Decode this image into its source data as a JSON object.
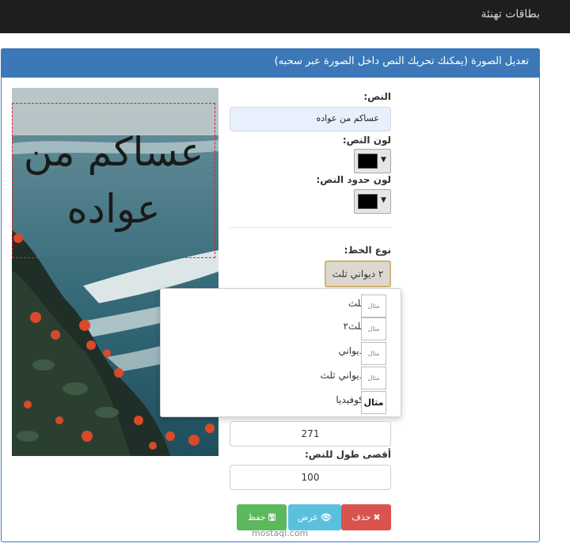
{
  "app": {
    "brand": "بطاقات تهنئة"
  },
  "panel": {
    "title": "تعديل الصورة (يمكنك تحريك النص داخل الصورة عبر سحبه)"
  },
  "card": {
    "line1": "عساكم من",
    "line2": "عواده"
  },
  "form": {
    "text_label": "النص:",
    "text_value": "عساكم من عواده",
    "text_color_label": "لون النص:",
    "text_color": "#000000",
    "border_color_label": "لون حدود النص:",
    "border_color": "#000000",
    "font_label": "نوع الخط:",
    "font_selected": "٢ ديواني ثلث",
    "number_value": "271",
    "max_length_label": "أقصى طول للنص:",
    "max_length_value": "100"
  },
  "font_options": [
    {
      "label": "ثلث",
      "thumb": "مثال"
    },
    {
      "label": "ثلث٢",
      "thumb": "مثال"
    },
    {
      "label": "ديواني",
      "thumb": "مثال"
    },
    {
      "label": "ديواني ثلث",
      "thumb": "مثال"
    },
    {
      "label": "كوفيديا",
      "thumb": "مثال"
    }
  ],
  "buttons": {
    "delete": "حذف",
    "view": "عرض",
    "save": "حفظ"
  },
  "icons": {
    "delete": "times-icon",
    "view": "eye-icon",
    "save": "floppy-icon",
    "caret": "caret-down-icon"
  },
  "colors": {
    "topbar": "#1e1e1e",
    "panel_header": "#3c78b8",
    "delete": "#d9534f",
    "view": "#5bc0de",
    "save": "#5cb85c"
  },
  "watermark": "mostaql.com"
}
